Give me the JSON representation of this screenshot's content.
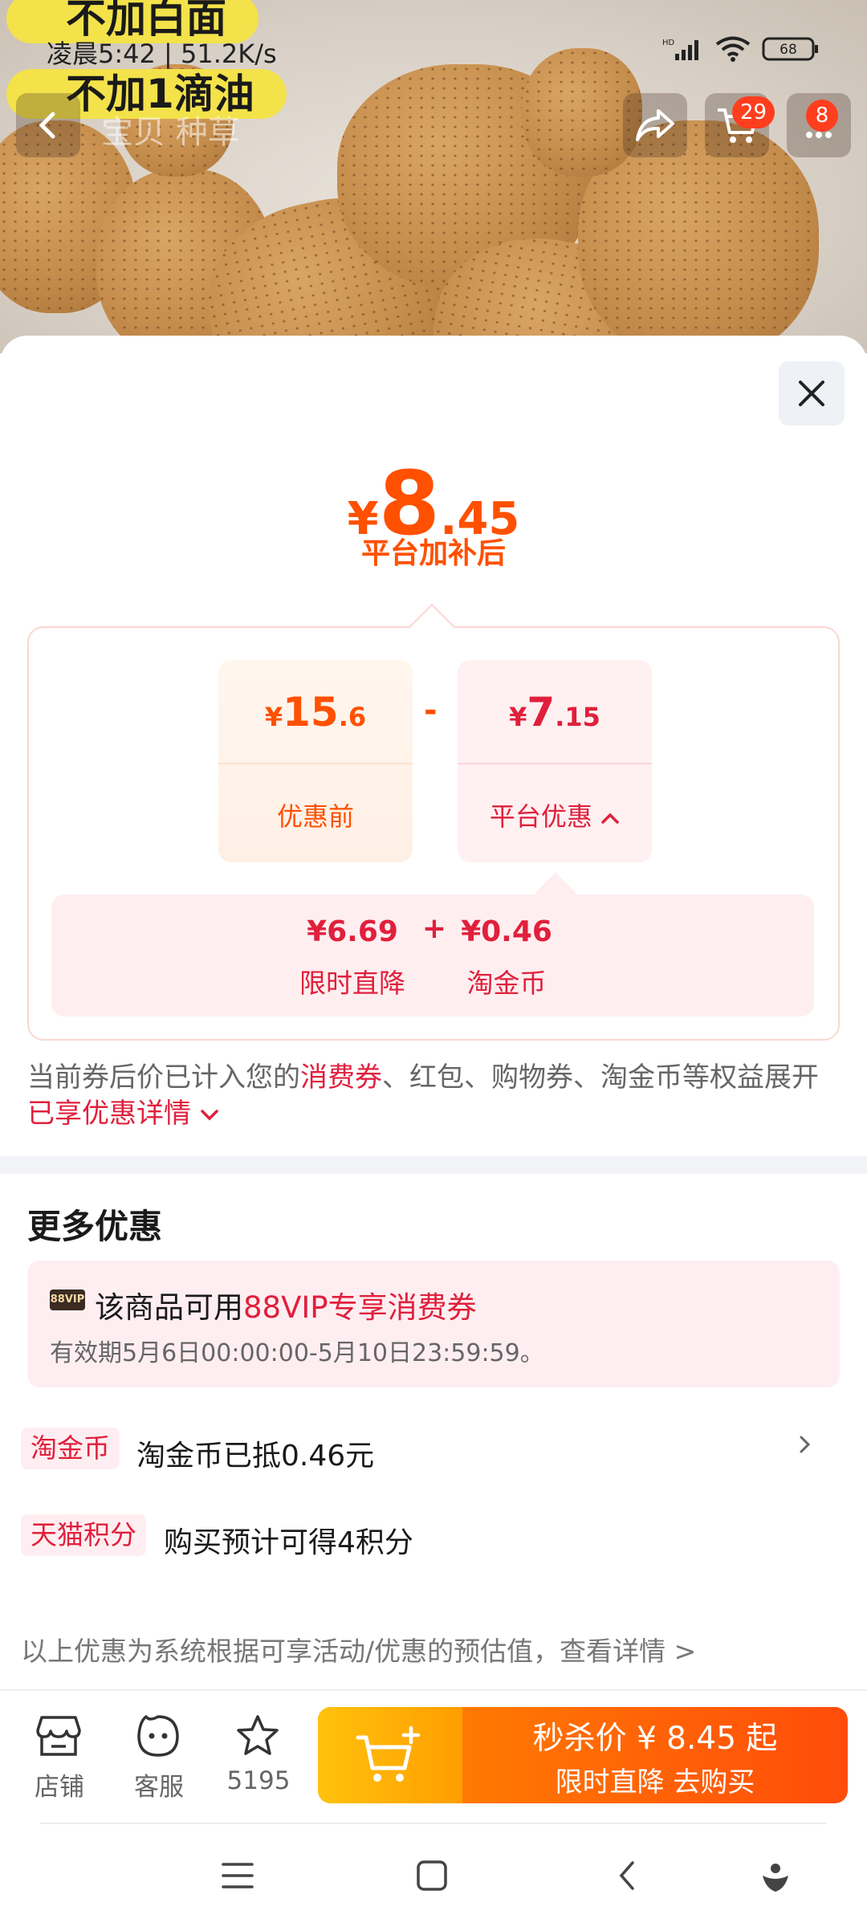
{
  "hero": {
    "caption_top": "不加白面",
    "caption_bottom": "不加1滴油",
    "status_time": "凌晨5:42 | 51.2K/s",
    "battery": "68",
    "tabs_text": "宝贝  种草",
    "cart_badge": "29",
    "menu_badge": "8"
  },
  "sheet": {
    "price": {
      "currency": "¥",
      "integer": "8",
      "decimal": ".45"
    },
    "subtitle": "平台加补后",
    "calc": {
      "original": {
        "currency": "¥",
        "integer": "15",
        "decimal": ".6",
        "label": "优惠前"
      },
      "minus": "-",
      "discount": {
        "currency": "¥",
        "integer": "7",
        "decimal": ".15",
        "label": "平台优惠"
      },
      "breakdown": [
        {
          "value": "¥6.69",
          "label": "限时直降"
        },
        {
          "value": "¥0.46",
          "label": "淘金币"
        }
      ],
      "plus": "+"
    },
    "note": {
      "part1": "当前券后价已计入您的",
      "highlight1": "消费券",
      "part2": "、红包、购物券、淘金币等权益展开",
      "highlight2": "已享优惠详情"
    },
    "more": {
      "title": "更多优惠",
      "vip": {
        "tag": "88VIP",
        "text": "该商品可用",
        "highlight": "88VIP专享消费券",
        "valid": "有效期5月6日00:00:00-5月10日23:59:59。"
      },
      "rows": [
        {
          "tag": "淘金币",
          "text": "淘金币已抵0.46元"
        },
        {
          "tag": "天猫积分",
          "text": "购买预计可得4积分"
        }
      ],
      "disclaimer": "以上优惠为系统根据可享活动/优惠的预估值，查看详情 >"
    }
  },
  "bottom_bar": {
    "shop": "店铺",
    "service": "客服",
    "favorites": "5195",
    "cta_line1": "秒杀价 ¥ 8.45 起",
    "cta_line2": "限时直降  去购买"
  },
  "colors": {
    "accent": "#ff5000",
    "red": "#e0203c",
    "pink_bg": "#ffeef0"
  }
}
